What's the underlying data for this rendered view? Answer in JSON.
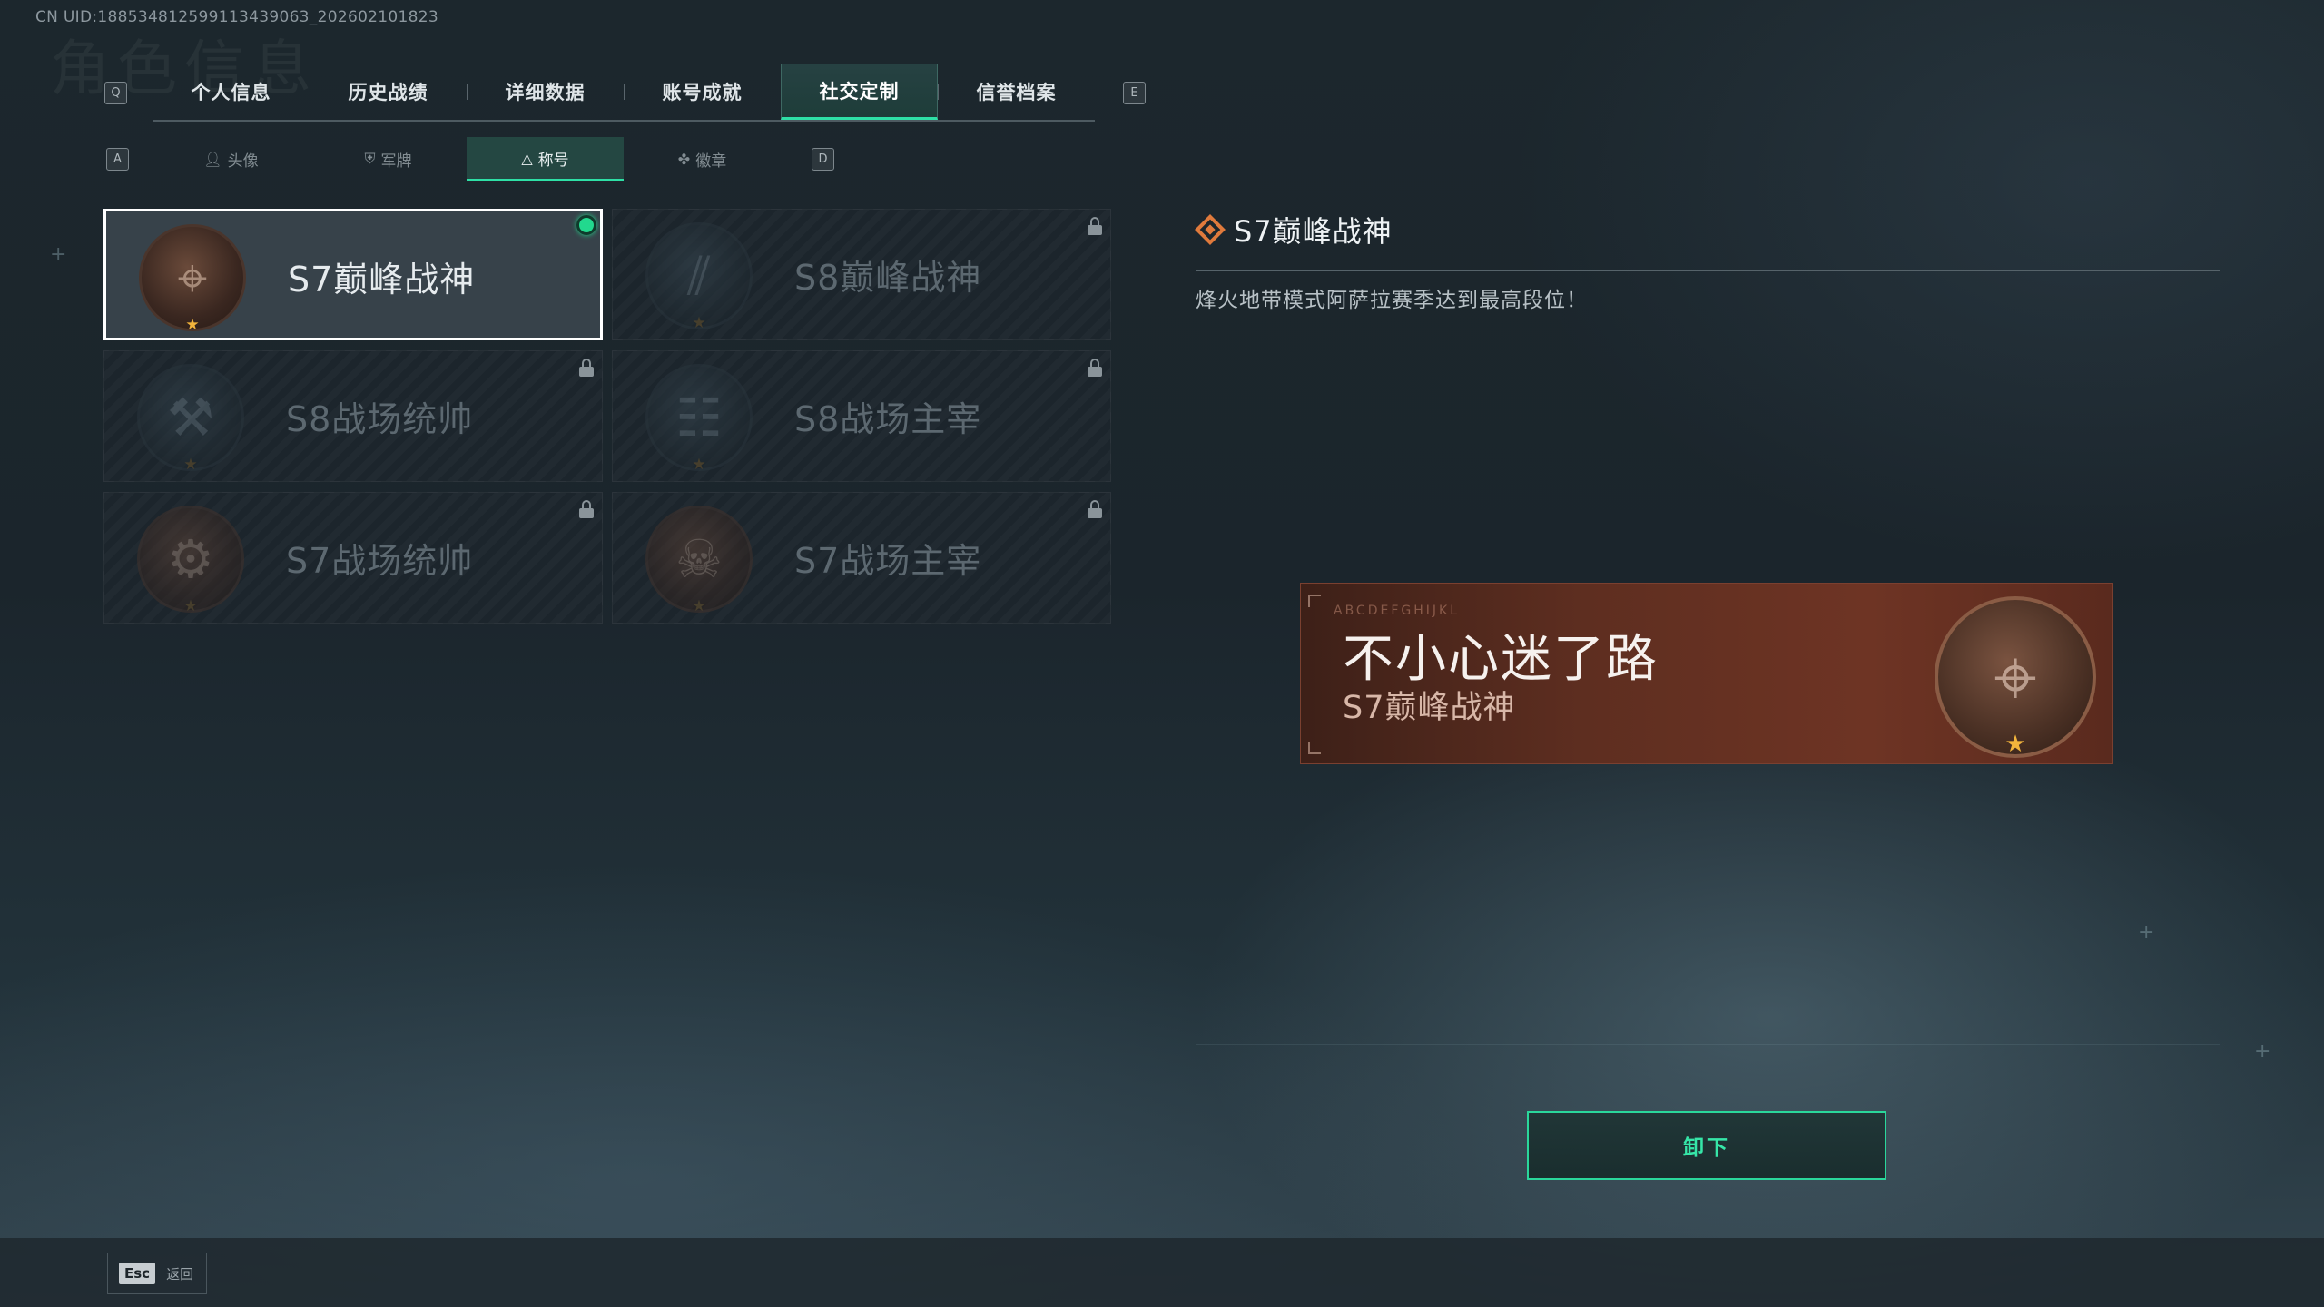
{
  "uid_text": "CN UID:18853481259911343906​3_202602101823",
  "watermark": "角色信息",
  "main_tabs": {
    "prev_key": "Q",
    "next_key": "E",
    "items": [
      {
        "label": "个人信息"
      },
      {
        "label": "历史战绩"
      },
      {
        "label": "详细数据"
      },
      {
        "label": "账号成就"
      },
      {
        "label": "社交定制",
        "active": true
      },
      {
        "label": "信誉档案"
      }
    ]
  },
  "sub_tabs": {
    "prev_key": "A",
    "next_key": "D",
    "items": [
      {
        "label": "头像",
        "icon": "person-icon"
      },
      {
        "label": "军牌",
        "icon": "shield-icon"
      },
      {
        "label": "称号",
        "icon": "triangle-emblem-icon",
        "active": true
      },
      {
        "label": "徽章",
        "icon": "wings-icon"
      }
    ]
  },
  "titles": [
    {
      "name": "S7巅峰战神",
      "emblem": "rifle-emblem",
      "equipped": true,
      "locked": false
    },
    {
      "name": "S8巅峰战神",
      "emblem": "slash-emblem",
      "equipped": false,
      "locked": true
    },
    {
      "name": "S8战场统帅",
      "emblem": "tank-emblem",
      "equipped": false,
      "locked": true
    },
    {
      "name": "S8战场主宰",
      "emblem": "building-emblem",
      "equipped": false,
      "locked": true
    },
    {
      "name": "S7战场统帅",
      "emblem": "vehicle-emblem",
      "equipped": false,
      "locked": true
    },
    {
      "name": "S7战场主宰",
      "emblem": "soldier-emblem",
      "equipped": false,
      "locked": true
    }
  ],
  "detail": {
    "title": "S7巅峰战神",
    "description": "烽火地带模式阿萨拉赛季达到最高段位！"
  },
  "preview": {
    "glyph_strip": "ABCDEFGHIJKL",
    "nickname": "不小心迷了路",
    "title": "S7巅峰战神"
  },
  "action_button": "卸下",
  "footer": {
    "esc_key": "Esc",
    "esc_label": "返回"
  },
  "colors": {
    "accent": "#2ee0a6",
    "equipped_dot": "#22d98e",
    "title_icon": "#e07a3c",
    "preview_bg": "#5e2e20"
  }
}
